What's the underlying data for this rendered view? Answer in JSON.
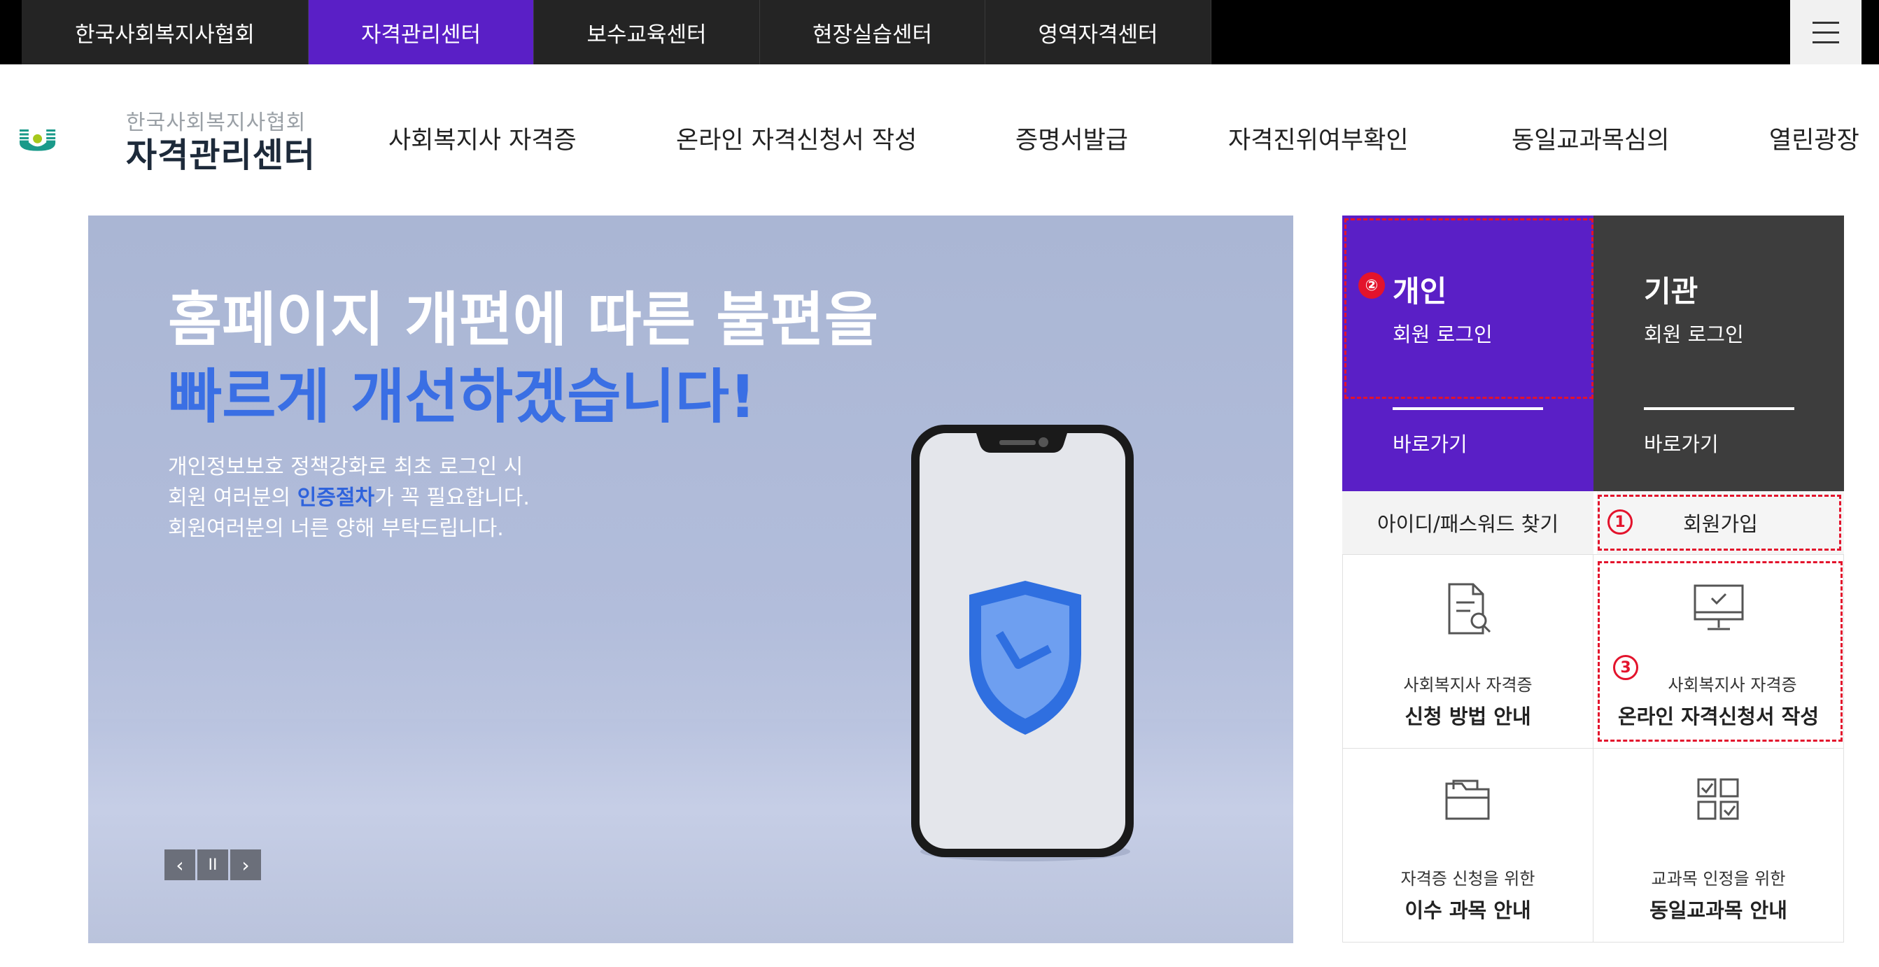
{
  "top_nav": {
    "tabs": [
      {
        "label": "한국사회복지사협회",
        "active": false
      },
      {
        "label": "자격관리센터",
        "active": true
      },
      {
        "label": "보수교육센터",
        "active": false
      },
      {
        "label": "현장실습센터",
        "active": false
      },
      {
        "label": "영역자격센터",
        "active": false
      }
    ],
    "menu_icon": "hamburger-icon"
  },
  "logo": {
    "small_text": "한국사회복지사협회",
    "big_text": "자격관리센터"
  },
  "main_nav": [
    "사회복지사 자격증",
    "온라인 자격신청서 작성",
    "증명서발급",
    "자격진위여부확인",
    "동일교과목심의",
    "열린광장"
  ],
  "banner": {
    "headline_line1": "홈페이지 개편에 따른 불편을",
    "headline_line2": "빠르게 개선하겠습니다!",
    "desc_line1": "개인정보보호 정책강화로 최초 로그인 시",
    "desc_line2_pre": "회원 여러분의 ",
    "desc_line2_highlight": "인증절차",
    "desc_line2_post": "가 꼭 필요합니다.",
    "desc_line3": "회원여러분의 너른 양해 부탁드립니다.",
    "controls": {
      "prev": "‹",
      "pause": "II",
      "next": "›"
    }
  },
  "login": {
    "individual": {
      "title": "개인",
      "subtitle": "회원 로그인",
      "go": "바로가기",
      "marker": "②"
    },
    "organization": {
      "title": "기관",
      "subtitle": "회원 로그인",
      "go": "바로가기"
    }
  },
  "account_links": {
    "find": "아이디/패스워드 찾기",
    "signup": "회원가입",
    "signup_marker": "1"
  },
  "quick_links": [
    {
      "small": "사회복지사 자격증",
      "big": "신청 방법 안내",
      "icon": "document-search-icon"
    },
    {
      "small": "사회복지사 자격증",
      "big": "온라인 자격신청서 작성",
      "icon": "monitor-check-icon",
      "marker": "3"
    },
    {
      "small": "자격증 신청을 위한",
      "big": "이수 과목 안내",
      "icon": "folder-icon"
    },
    {
      "small": "교과목 인정을 위한",
      "big": "동일교과목 안내",
      "icon": "checklist-grid-icon"
    }
  ],
  "colors": {
    "brand_purple": "#5a1fc6",
    "annotation_red": "#e3132c",
    "banner_blue": "#3a6fe4",
    "dark_panel": "#3d3d3d"
  }
}
